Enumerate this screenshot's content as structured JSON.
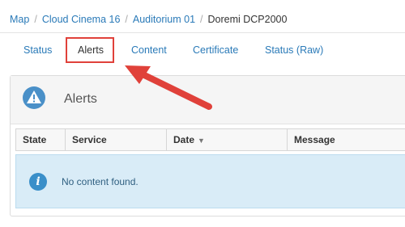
{
  "breadcrumb": {
    "items": [
      "Map",
      "Cloud Cinema 16",
      "Auditorium 01"
    ],
    "current": "Doremi DCP2000",
    "separator": "/"
  },
  "tabs": [
    {
      "label": "Status",
      "active": false
    },
    {
      "label": "Alerts",
      "active": true
    },
    {
      "label": "Content",
      "active": false
    },
    {
      "label": "Certificate",
      "active": false
    },
    {
      "label": "Status (Raw)",
      "active": false
    }
  ],
  "panel": {
    "title": "Alerts",
    "icon": "warning-triangle-icon"
  },
  "table": {
    "columns": [
      "State",
      "Service",
      "Date",
      "Message"
    ],
    "sorted_column": "Date",
    "sort_indicator": "▼",
    "empty_message": "No content found.",
    "empty_icon": "info-icon"
  },
  "annotation": {
    "highlight_color": "#e0413a",
    "arrow_color": "#e0413a"
  },
  "colors": {
    "link": "#2a7ab8",
    "info_bg": "#d9ecf7",
    "info_icon": "#3a8fc9"
  }
}
